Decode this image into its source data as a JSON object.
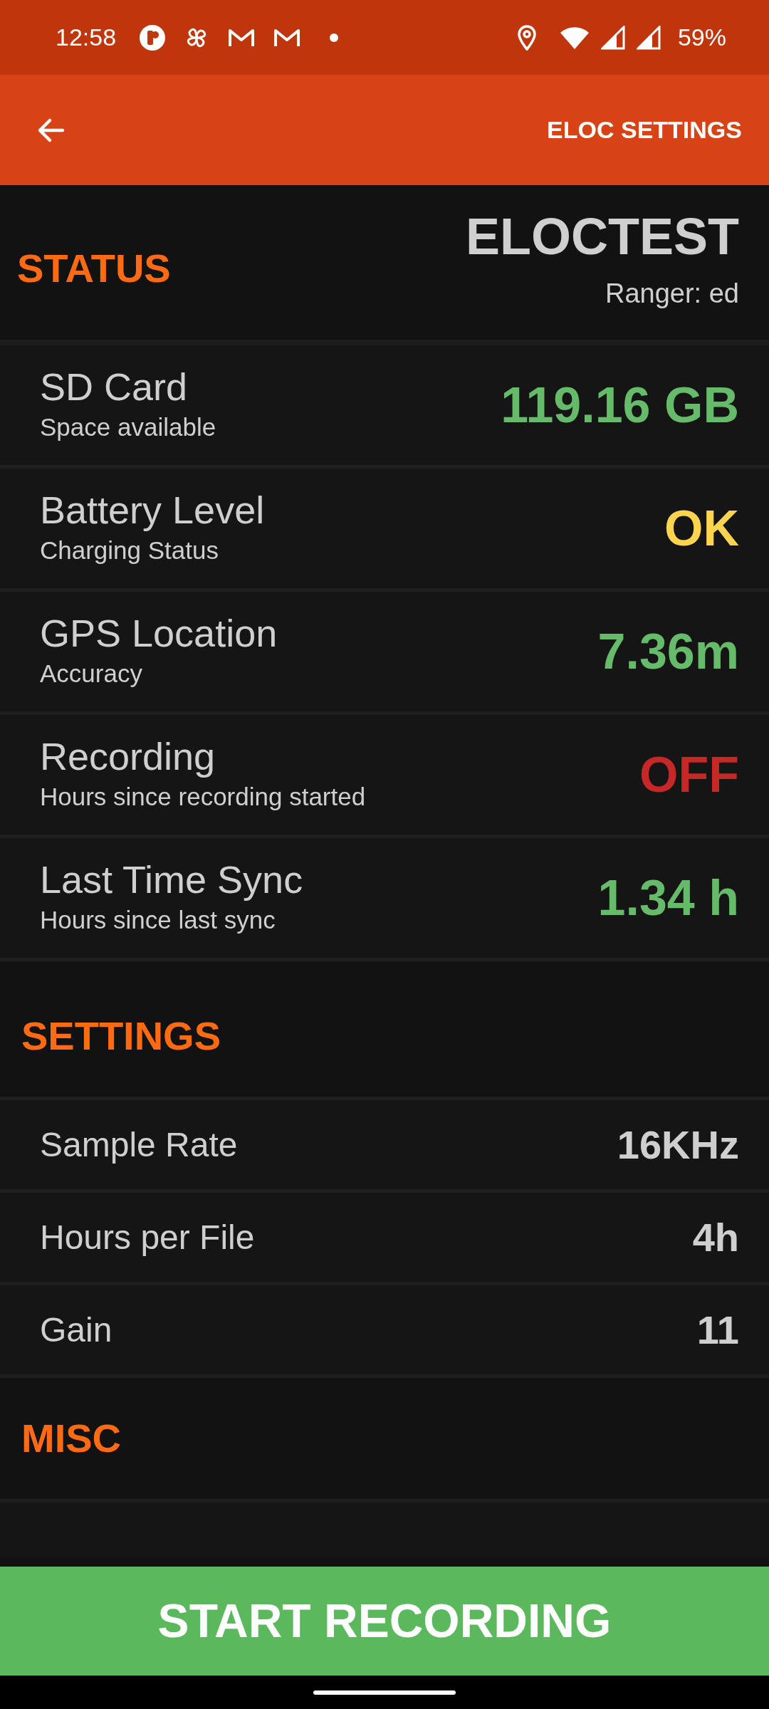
{
  "status_bar": {
    "time": "12:58",
    "battery": "59%"
  },
  "app_bar": {
    "title": "ELOC SETTINGS"
  },
  "status": {
    "heading": "STATUS",
    "device": "ELOCTEST",
    "ranger": "Ranger: ed",
    "items": [
      {
        "title": "SD Card",
        "subtitle": "Space available",
        "value": "119.16 GB",
        "color": "#66bb6a"
      },
      {
        "title": "Battery Level",
        "subtitle": "Charging Status",
        "value": "OK",
        "color": "#ffd54f"
      },
      {
        "title": "GPS Location",
        "subtitle": "Accuracy",
        "value": "7.36m",
        "color": "#66bb6a"
      },
      {
        "title": "Recording",
        "subtitle": "Hours since recording started",
        "value": "OFF",
        "color": "#c62828"
      },
      {
        "title": "Last Time Sync",
        "subtitle": "Hours since last sync",
        "value": "1.34 h",
        "color": "#66bb6a"
      }
    ]
  },
  "settings": {
    "heading": "SETTINGS",
    "items": [
      {
        "label": "Sample Rate",
        "value": "16KHz"
      },
      {
        "label": "Hours per File",
        "value": "4h"
      },
      {
        "label": "Gain",
        "value": "11"
      }
    ]
  },
  "misc": {
    "heading": "MISC"
  },
  "action_button": "START RECORDING"
}
